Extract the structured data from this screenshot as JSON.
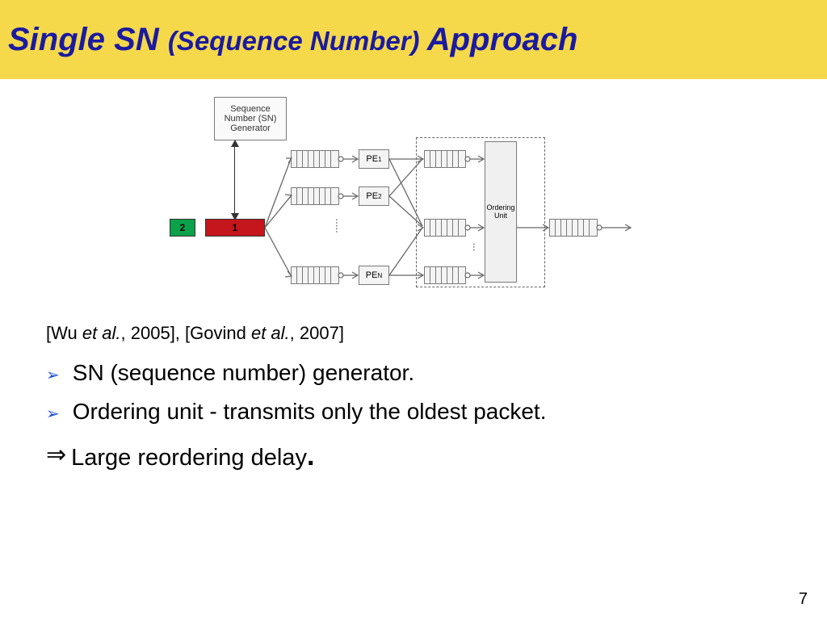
{
  "title": {
    "main1": "Single SN ",
    "sub": "(Sequence Number) ",
    "main2": "Approach"
  },
  "diagram": {
    "sn_gen": "Sequence Number (SN) Generator",
    "packet2": "2",
    "packet1": "1",
    "pe1": "PE",
    "pe1_sub": "1",
    "pe2": "PE",
    "pe2_sub": "2",
    "peN": "PE",
    "peN_sub": "N",
    "ordering": "Ordering Unit"
  },
  "refs": {
    "pre": "[Wu ",
    "it1": "et al.",
    "mid": ", 2005], [Govind ",
    "it2": "et al.",
    "post": ", 2007]"
  },
  "bullets": [
    "SN (sequence number) generator.",
    "Ordering unit - transmits only the oldest packet."
  ],
  "conclusion": "Large reordering delay",
  "page": "7"
}
